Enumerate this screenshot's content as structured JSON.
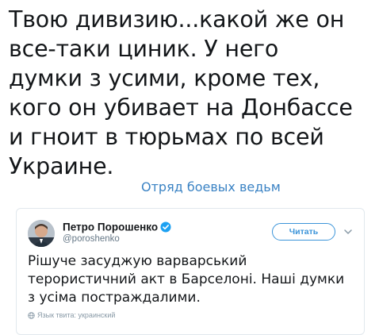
{
  "tweet": {
    "text_lines": [
      "Твою дивизию...какой же он",
      "все-таки циник. У него",
      "думки з усими, кроме тех,",
      "кого он убивает на Донбассе",
      "и гноит в тюрьмах по всей",
      "Украине."
    ]
  },
  "watermark": {
    "text": "Отряд боевых ведьм"
  },
  "quoted_tweet": {
    "author_name": "Петро Порошенко",
    "handle": "@poroshenko",
    "follow_label": "Читать",
    "text_lines": [
      "Рішуче засуджую варварський",
      "терористичний акт в Барселоні. Наші думки",
      "з усіма постраждалими."
    ],
    "language_label": "Язык твита: украинский",
    "icons": {
      "verified": "verified-badge-icon",
      "menu": "chevron-down-icon",
      "language": "globe-icon"
    }
  },
  "colors": {
    "text": "#14171a",
    "accent": "#3b94d9",
    "watermark": "#3b83c4",
    "muted": "#657786",
    "border": "#e1e8ed"
  }
}
